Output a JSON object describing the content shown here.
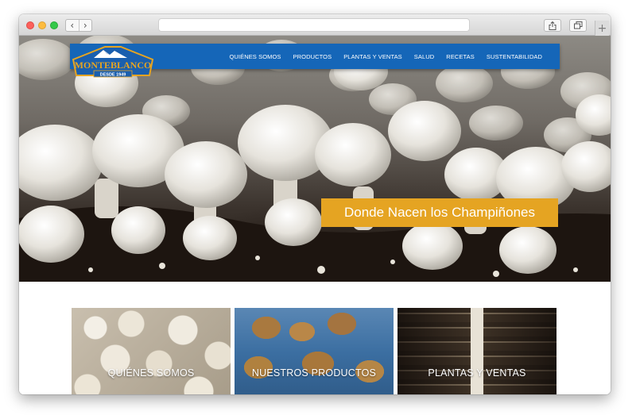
{
  "browser": {
    "back_glyph": "‹",
    "forward_glyph": "›",
    "address_value": "",
    "new_tab_glyph": "+",
    "icons": [
      "share-icon",
      "tabs-icon"
    ]
  },
  "site": {
    "logo": {
      "name": "MONTEBLANCO",
      "tagline": "DESDE 1949",
      "colors": {
        "blue": "#1a5fae",
        "gold": "#e5a422"
      }
    },
    "nav": {
      "background": "#1566b8",
      "items": [
        {
          "label": "QUIÉNES SOMOS"
        },
        {
          "label": "PRODUCTOS"
        },
        {
          "label": "PLANTAS Y VENTAS"
        },
        {
          "label": "SALUD"
        },
        {
          "label": "RECETAS"
        },
        {
          "label": "SUSTENTABILIDAD"
        }
      ]
    },
    "hero": {
      "caption": "Donde Nacen los Champiñones",
      "caption_color": "#e5a422"
    },
    "tiles": [
      {
        "label": "QUIÉNES SOMOS"
      },
      {
        "label": "NUESTROS PRODUCTOS"
      },
      {
        "label": "PLANTAS Y VENTAS"
      }
    ]
  }
}
